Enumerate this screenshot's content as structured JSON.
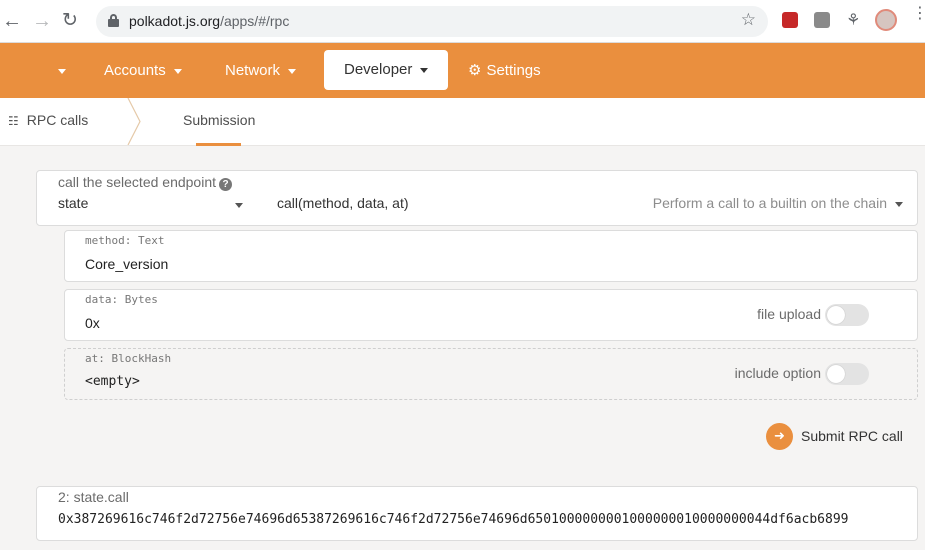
{
  "browser": {
    "url_host": "polkadot.js.org",
    "url_path": "/apps/#/rpc"
  },
  "topnav": {
    "accounts": "Accounts",
    "network": "Network",
    "developer": "Developer",
    "settings": "Settings",
    "accent_color": "#ea8f3e"
  },
  "subnav": {
    "rpc_calls": "RPC calls",
    "submission": "Submission"
  },
  "endpoint": {
    "label": "call the selected endpoint",
    "section": "state",
    "method": "call(method, data, at)",
    "description": "Perform a call to a builtin on the chain"
  },
  "params": [
    {
      "label": "method: Text",
      "value": "Core_version"
    },
    {
      "label": "data: Bytes",
      "value": "0x",
      "toggle_label": "file upload"
    },
    {
      "label": "at: BlockHash",
      "value": "<empty>",
      "toggle_label": "include option"
    }
  ],
  "submit": {
    "label": "Submit RPC call"
  },
  "result": {
    "label": "2: state.call",
    "value": "0x387269616c746f2d72756e74696d65387269616c746f2d72756e74696d6501000000001000000010000000044df6acb6899"
  }
}
